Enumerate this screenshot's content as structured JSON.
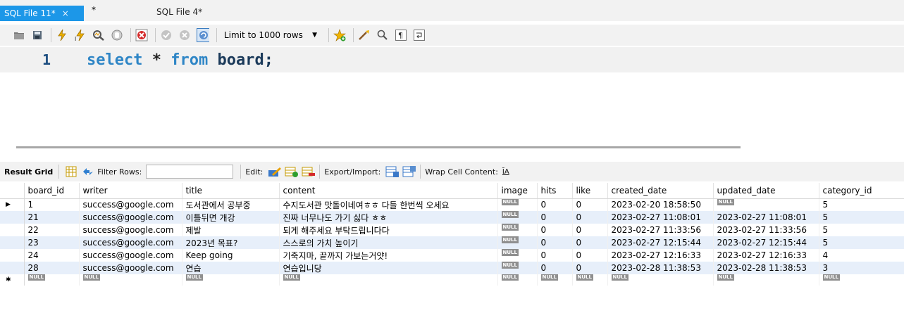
{
  "tabs": {
    "active": "SQL File 11*",
    "close_glyph": "×",
    "star": "*",
    "inactive": "SQL File 4*"
  },
  "toolbar": {
    "icons": [
      "open-folder-icon",
      "save-icon",
      "execute-icon",
      "execute-current-icon",
      "explain-icon",
      "stop-icon",
      "toggle-error-icon",
      "commit-icon",
      "rollback-icon",
      "autocommit-icon"
    ],
    "limit_label": "Limit to 1000 rows",
    "right_icons": [
      "add-snippet-icon",
      "beautify-icon",
      "find-icon",
      "invisible-chars-icon",
      "wrap-icon"
    ]
  },
  "editor": {
    "line_number": "1",
    "kw_select": "select",
    "star": " * ",
    "kw_from": "from",
    "table": " board;"
  },
  "result_toolbar": {
    "result_grid": "Result Grid",
    "filter_rows": "Filter Rows:",
    "edit": "Edit:",
    "export_import": "Export/Import:",
    "wrap_cell": "Wrap Cell Content:",
    "wrap_glyph": "ĪA"
  },
  "grid": {
    "columns": [
      "board_id",
      "writer",
      "title",
      "content",
      "image",
      "hits",
      "like",
      "created_date",
      "updated_date",
      "category_id"
    ],
    "null_label": "NULL",
    "row_marker": "▶",
    "new_marker": "✱",
    "rows": [
      {
        "board_id": "1",
        "writer": "success@google.com",
        "title": "도서관에서 공부중",
        "content": "수지도서관 맛돌이네여ㅎㅎ 다들 한번씩 오세요",
        "hits": "0",
        "like": "0",
        "created_date": "2023-02-20 18:58:50",
        "updated_date": "",
        "category_id": "5"
      },
      {
        "board_id": "21",
        "writer": "success@google.com",
        "title": "이틀뒤면 개강",
        "content": "진짜 너무나도 가기 싫다 ㅎㅎ",
        "hits": "0",
        "like": "0",
        "created_date": "2023-02-27 11:08:01",
        "updated_date": "2023-02-27 11:08:01",
        "category_id": "5"
      },
      {
        "board_id": "22",
        "writer": "success@google.com",
        "title": "제발",
        "content": "되게 해주세요 부탁드립니다다",
        "hits": "0",
        "like": "0",
        "created_date": "2023-02-27 11:33:56",
        "updated_date": "2023-02-27 11:33:56",
        "category_id": "5"
      },
      {
        "board_id": "23",
        "writer": "success@google.com",
        "title": "2023년 목표?",
        "content": "스스로의 가치 높이기",
        "hits": "0",
        "like": "0",
        "created_date": "2023-02-27 12:15:44",
        "updated_date": "2023-02-27 12:15:44",
        "category_id": "5"
      },
      {
        "board_id": "24",
        "writer": "success@google.com",
        "title": "Keep going",
        "content": "기죽지마, 끝까지 가보는거얏!",
        "hits": "0",
        "like": "0",
        "created_date": "2023-02-27 12:16:33",
        "updated_date": "2023-02-27 12:16:33",
        "category_id": "4"
      },
      {
        "board_id": "28",
        "writer": "success@google.com",
        "title": "연습",
        "content": "연습입니당",
        "hits": "0",
        "like": "0",
        "created_date": "2023-02-28 11:38:53",
        "updated_date": "2023-02-28 11:38:53",
        "category_id": "3"
      }
    ]
  },
  "colors": {
    "tab_active": "#1c97e8",
    "keyword": "#2f86c6",
    "alt_row": "#e7effa",
    "null_badge": "#8f8f8f"
  }
}
